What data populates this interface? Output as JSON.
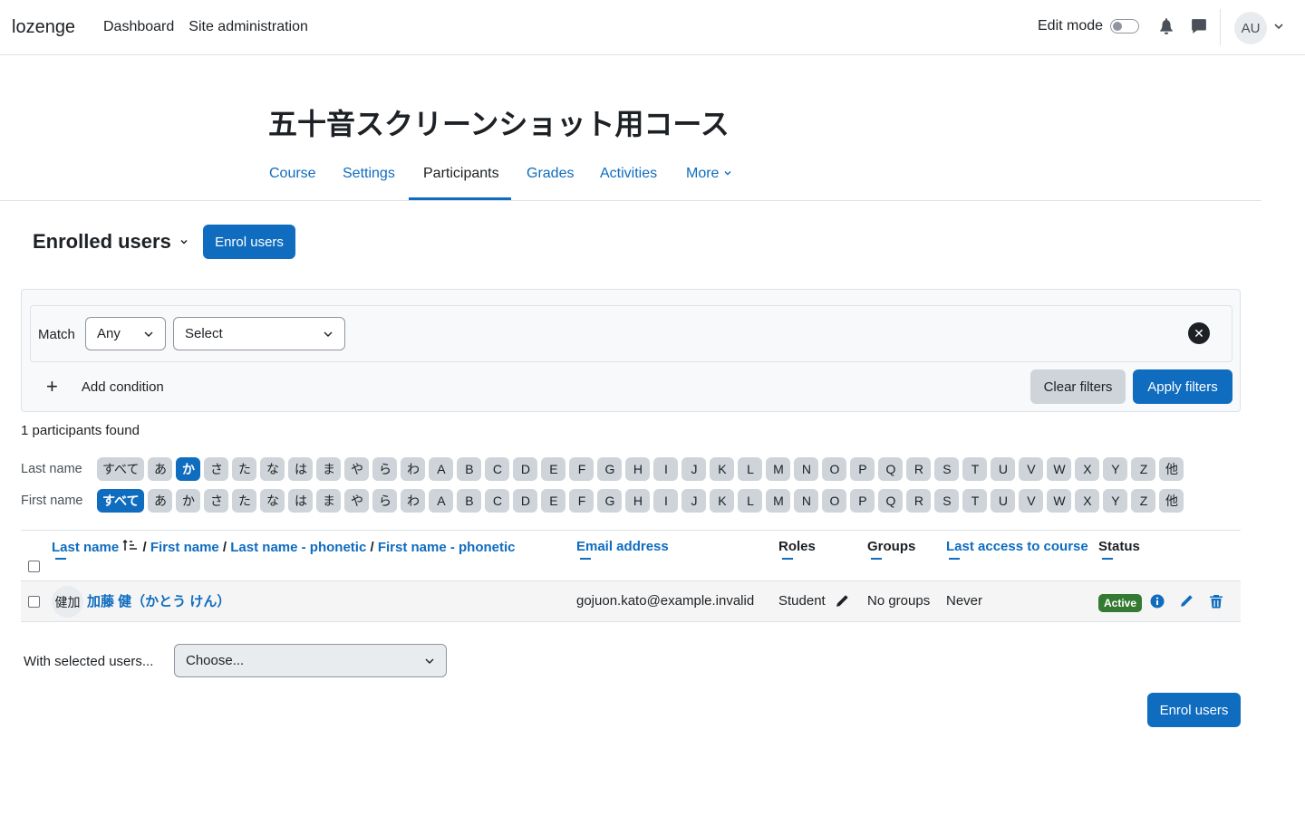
{
  "navbar": {
    "brand": "lozenge",
    "items": [
      "Dashboard",
      "Site administration"
    ],
    "edit_mode_label": "Edit mode",
    "user_initials": "AU"
  },
  "course": {
    "title": "五十音スクリーンショット用コース",
    "tabs": [
      "Course",
      "Settings",
      "Participants",
      "Grades",
      "Activities",
      "More"
    ],
    "active_tab": "Participants"
  },
  "page": {
    "heading": "Enrolled users",
    "enrol_button": "Enrol users"
  },
  "filters": {
    "match_label": "Match",
    "match_value": "Any",
    "type_placeholder": "Select",
    "add_condition": "Add condition",
    "clear_filters": "Clear filters",
    "apply_filters": "Apply filters"
  },
  "found_text": "1 participants found",
  "initials": {
    "last_label": "Last name",
    "first_label": "First name",
    "letters": [
      "すべて",
      "あ",
      "か",
      "さ",
      "た",
      "な",
      "は",
      "ま",
      "や",
      "ら",
      "わ",
      "A",
      "B",
      "C",
      "D",
      "E",
      "F",
      "G",
      "H",
      "I",
      "J",
      "K",
      "L",
      "M",
      "N",
      "O",
      "P",
      "Q",
      "R",
      "S",
      "T",
      "U",
      "V",
      "W",
      "X",
      "Y",
      "Z",
      "他"
    ],
    "last_active": "か",
    "first_active": "すべて"
  },
  "table": {
    "headers": {
      "last_name": "Last name",
      "first_name": "First name",
      "last_phonetic": "Last name - phonetic",
      "first_phonetic": "First name - phonetic",
      "email": "Email address",
      "roles": "Roles",
      "groups": "Groups",
      "last_access": "Last access to course",
      "status": "Status"
    },
    "rows": [
      {
        "avatar": "健加",
        "name": "加藤 健（かとう けん）",
        "email": "gojuon.kato@example.invalid",
        "role": "Student",
        "groups": "No groups",
        "last_access": "Never",
        "status": "Active"
      }
    ]
  },
  "bulk": {
    "label": "With selected users...",
    "placeholder": "Choose..."
  },
  "colors": {
    "primary": "#0f6cbf",
    "success": "#357a32",
    "secondary": "#ced4da"
  }
}
